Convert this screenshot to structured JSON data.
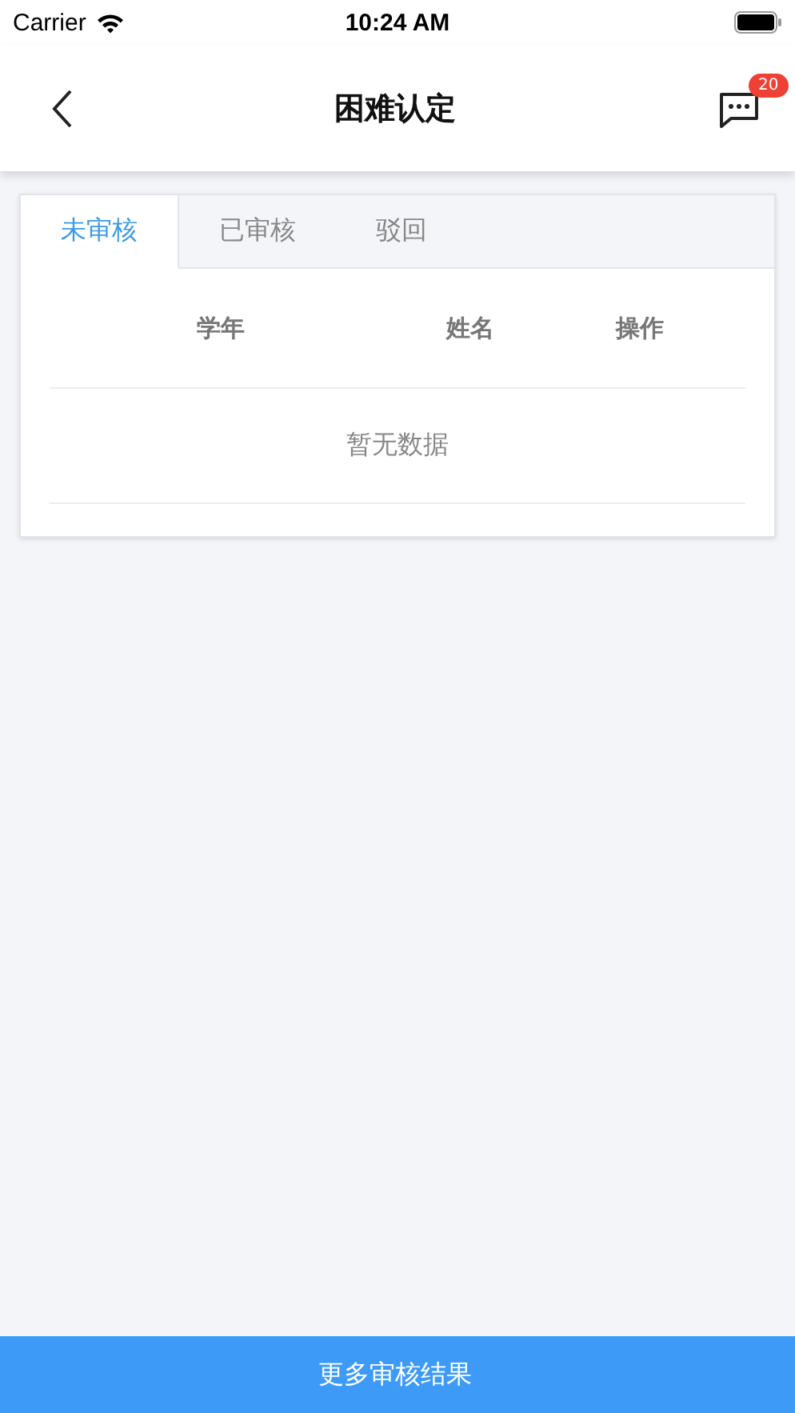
{
  "status_bar": {
    "carrier": "Carrier",
    "time": "10:24 AM"
  },
  "nav": {
    "title": "困难认定",
    "badge": "20"
  },
  "tabs": [
    {
      "label": "未审核",
      "selected": true
    },
    {
      "label": "已审核",
      "selected": false
    },
    {
      "label": "驳回",
      "selected": false
    }
  ],
  "table": {
    "columns": [
      "学年",
      "姓名",
      "操作"
    ],
    "empty_text": "暂无数据"
  },
  "bottom_bar": {
    "label": "更多审核结果"
  }
}
